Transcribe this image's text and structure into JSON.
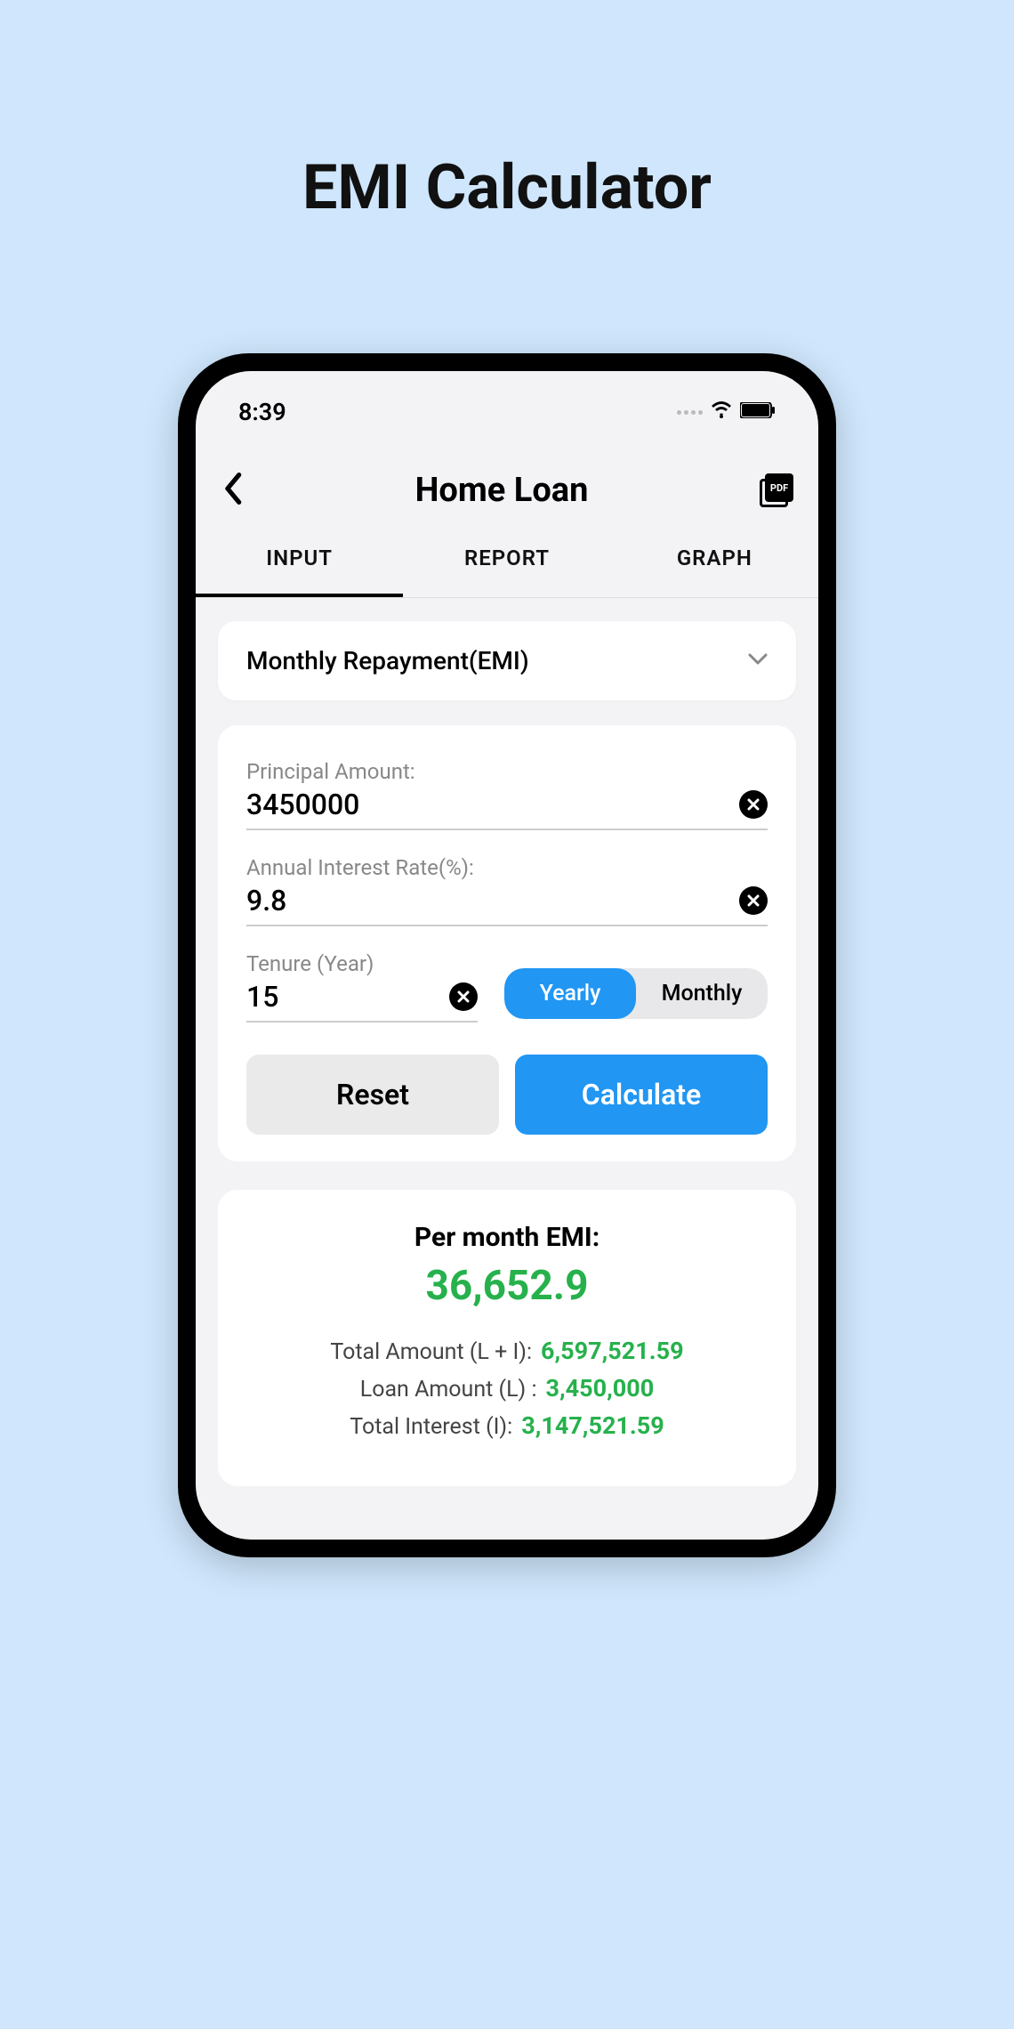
{
  "page": {
    "title": "EMI Calculator"
  },
  "status": {
    "time": "8:39"
  },
  "header": {
    "title": "Home Loan",
    "pdf_label": "PDF"
  },
  "tabs": [
    {
      "label": "INPUT",
      "active": true
    },
    {
      "label": "REPORT",
      "active": false
    },
    {
      "label": "GRAPH",
      "active": false
    }
  ],
  "dropdown": {
    "selected": "Monthly Repayment(EMI)"
  },
  "fields": {
    "principal": {
      "label": "Principal Amount:",
      "value": "3450000"
    },
    "rate": {
      "label": "Annual Interest Rate(%):",
      "value": "9.8"
    },
    "tenure": {
      "label": "Tenure (Year)",
      "value": "15"
    }
  },
  "toggle": {
    "yearly": "Yearly",
    "monthly": "Monthly"
  },
  "buttons": {
    "reset": "Reset",
    "calculate": "Calculate"
  },
  "results": {
    "emi_label": "Per month EMI:",
    "emi_value": "36,652.9",
    "total_amount": {
      "label": "Total Amount (L + I):",
      "value": "6,597,521.59"
    },
    "loan_amount": {
      "label": "Loan Amount (L) :",
      "value": "3,450,000"
    },
    "total_interest": {
      "label": "Total Interest (I):",
      "value": "3,147,521.59"
    }
  }
}
